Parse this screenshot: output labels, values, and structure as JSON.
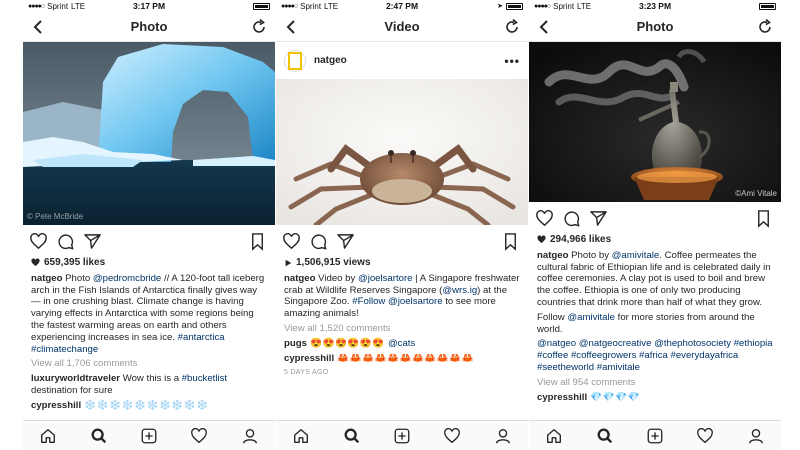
{
  "status": [
    {
      "carrier": "Sprint",
      "network": "LTE",
      "time": "3:17 PM"
    },
    {
      "carrier": "Sprint",
      "network": "LTE",
      "time": "2:47 PM"
    },
    {
      "carrier": "Sprint",
      "network": "LTE",
      "time": "3:23 PM"
    }
  ],
  "screens": [
    {
      "nav_title": "Photo",
      "photo_credit": "© Pete McBride",
      "likes": "659,395 likes",
      "caption_user": "natgeo",
      "caption_pre": "Photo ",
      "caption_mention": "@pedromcbride",
      "caption_text": " // A 120-foot tall iceberg arch in the Fish Islands of Antarctica finally gives way — in one crushing blast. Climate change is having varying effects in Antarctica with some regions being the fastest warming areas on earth and others experiencing increases in sea ice. ",
      "caption_tags": "#antarctica #climatechange",
      "view_comments": "View all 1,706 comments",
      "comment1_user": "luxuryworldtraveler",
      "comment1_text": " Wow this is a ",
      "comment1_tag": "#bucketlist",
      "comment1_tail": " destination  for sure",
      "comment2_user": "cypresshill",
      "comment2_text": " ❄️❄️❄️❄️❄️❄️❄️❄️❄️❄️"
    },
    {
      "nav_title": "Video",
      "username": "natgeo",
      "more": "•••",
      "views": "1,506,915 views",
      "caption_user": "natgeo",
      "caption_pre": "Video by ",
      "caption_mention": "@joelsartore",
      "caption_text": " | A Singapore freshwater crab at Wildlife Reserves Singapore (",
      "caption_mention2": "@wrs.ig",
      "caption_text2": ") at the Singapore Zoo. ",
      "caption_tag": "#Follow",
      "caption_sp": " ",
      "caption_mention3": "@joelsartore",
      "caption_text3": " to see more amazing animals!",
      "view_comments": "View all 1,520 comments",
      "comment1_user": "pugs",
      "comment1_text": " 😍😍😍😍😍😍 ",
      "comment1_mention": "@cats",
      "comment2_user": "cypresshill",
      "comment2_text": " 🦀🦀🦀🦀🦀🦀🦀🦀🦀🦀🦀",
      "time_ago": "5 DAYS AGO"
    },
    {
      "nav_title": "Photo",
      "photo_credit": "©Ami Vitale",
      "likes": "294,966 likes",
      "caption_user": "natgeo",
      "caption_pre": "Photo by ",
      "caption_mention": "@amivitale",
      "caption_text": ". Coffee permeates the cultural fabric of Ethiopian life and is celebrated daily in coffee ceremonies. A clay pot is used to boil and brew the coffee. Ethiopia is one of only two producing countries that drink more than half of what they grow.",
      "follow_pre": "Follow ",
      "follow_mention": "@amivitale",
      "follow_text": " for more stories from around the world.",
      "tags": "@natgeo @natgeocreative @thephotosociety #ethiopia #coffee #coffeegrowers #africa #everydayafrica #seetheworld #amivitale",
      "view_comments": "View all 954 comments",
      "comment1_user": "cypresshill",
      "comment1_text": " 💎💎💎💎"
    }
  ],
  "icons": {
    "back": "chevron-left-icon",
    "refresh": "refresh-icon",
    "like": "heart-icon",
    "comment": "comment-icon",
    "share": "paper-plane-icon",
    "save": "bookmark-icon",
    "tabs": [
      "home-icon",
      "search-icon",
      "add-icon",
      "activity-heart-icon",
      "profile-icon"
    ]
  },
  "colors": {
    "link": "#003569",
    "muted": "#999999",
    "text": "#262626"
  }
}
